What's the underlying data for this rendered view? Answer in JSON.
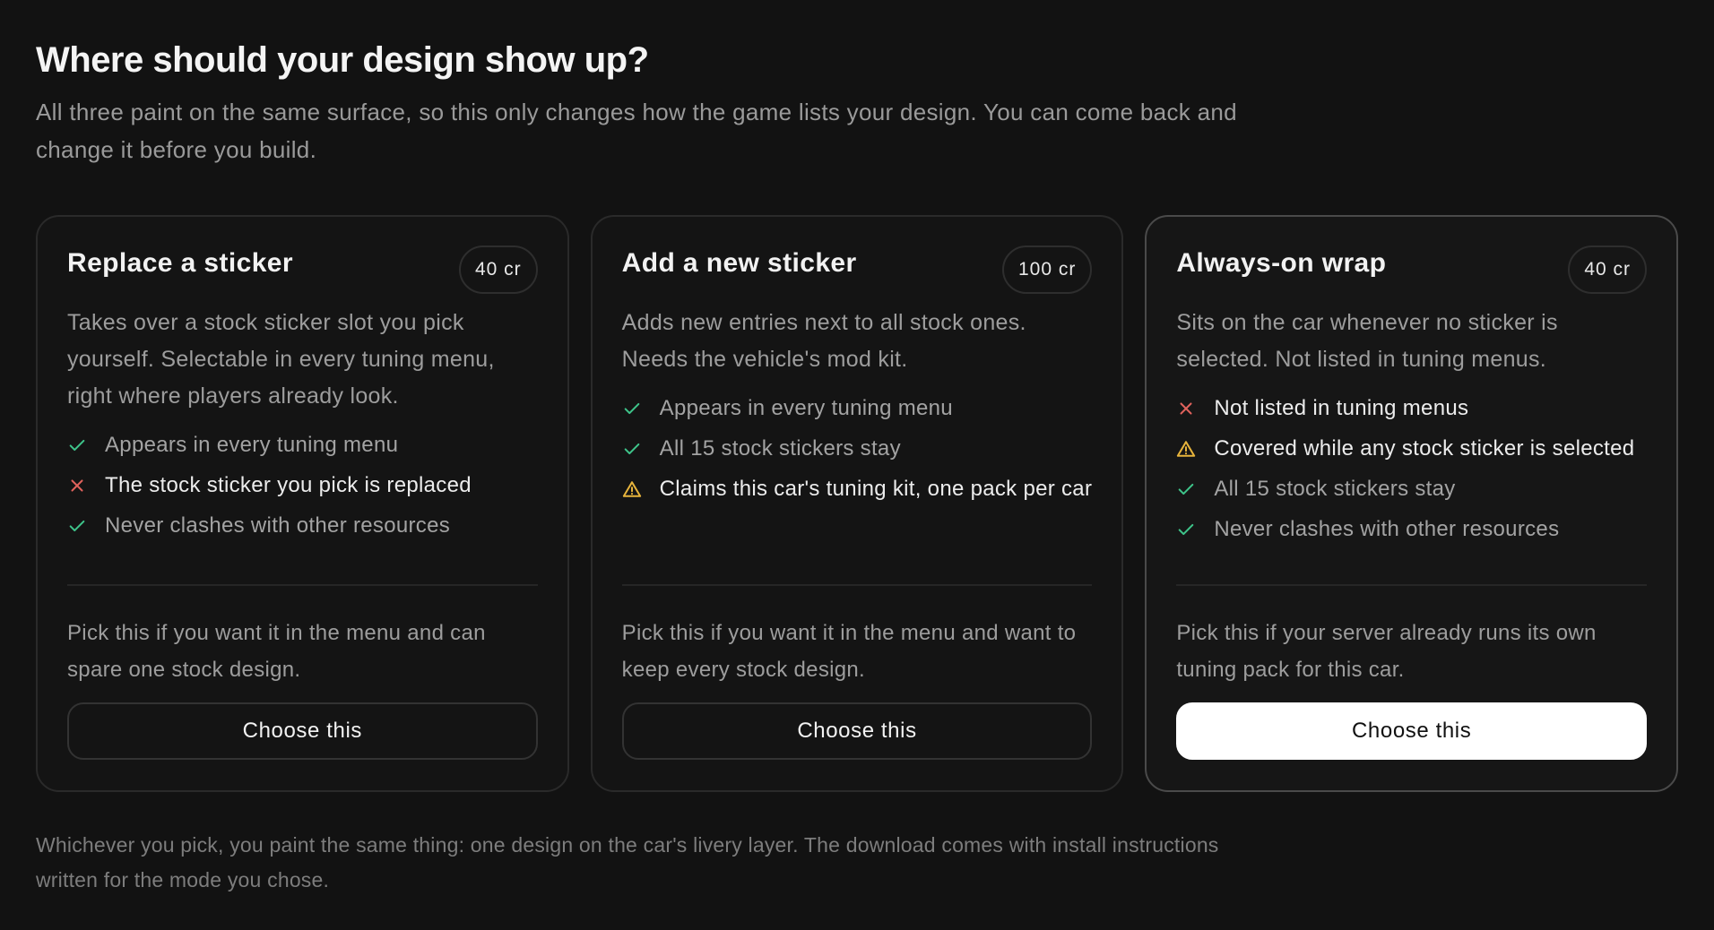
{
  "header": {
    "title": "Where should your design show up?",
    "subtitle": "All three paint on the same surface, so this only changes how the game lists your design. You can come back and change it before you build."
  },
  "colors": {
    "check": "#3ec48a",
    "cross": "#e0625c",
    "warn": "#e7b43c"
  },
  "cards": [
    {
      "title": "Replace a sticker",
      "price": "40 cr",
      "description": "Takes over a stock sticker slot you pick yourself. Selectable in every tuning menu, right where players already look.",
      "features": [
        {
          "type": "check",
          "icon": "check-icon",
          "text": "Appears in every tuning menu"
        },
        {
          "type": "cross",
          "icon": "cross-icon",
          "text": "The stock sticker you pick is replaced"
        },
        {
          "type": "check",
          "icon": "check-icon",
          "text": "Never clashes with other resources"
        }
      ],
      "pick_text": "Pick this if you want it in the menu and can spare one stock design.",
      "button": "Choose this",
      "selected": false
    },
    {
      "title": "Add a new sticker",
      "price": "100 cr",
      "description": "Adds new entries next to all stock ones. Needs the vehicle's mod kit.",
      "features": [
        {
          "type": "check",
          "icon": "check-icon",
          "text": "Appears in every tuning menu"
        },
        {
          "type": "check",
          "icon": "check-icon",
          "text": "All 15 stock stickers stay"
        },
        {
          "type": "warn",
          "icon": "warning-icon",
          "text": "Claims this car's tuning kit, one pack per car"
        }
      ],
      "pick_text": "Pick this if you want it in the menu and want to keep every stock design.",
      "button": "Choose this",
      "selected": false
    },
    {
      "title": "Always-on wrap",
      "price": "40 cr",
      "description": "Sits on the car whenever no sticker is selected. Not listed in tuning menus.",
      "features": [
        {
          "type": "cross",
          "icon": "cross-icon",
          "text": "Not listed in tuning menus"
        },
        {
          "type": "warn",
          "icon": "warning-icon",
          "text": "Covered while any stock sticker is selected"
        },
        {
          "type": "check",
          "icon": "check-icon",
          "text": "All 15 stock stickers stay"
        },
        {
          "type": "check",
          "icon": "check-icon",
          "text": "Never clashes with other resources"
        }
      ],
      "pick_text": "Pick this if your server already runs its own tuning pack for this car.",
      "button": "Choose this",
      "selected": true
    }
  ],
  "footnote": "Whichever you pick, you paint the same thing: one design on the car's livery layer. The download comes with install instructions written for the mode you chose."
}
